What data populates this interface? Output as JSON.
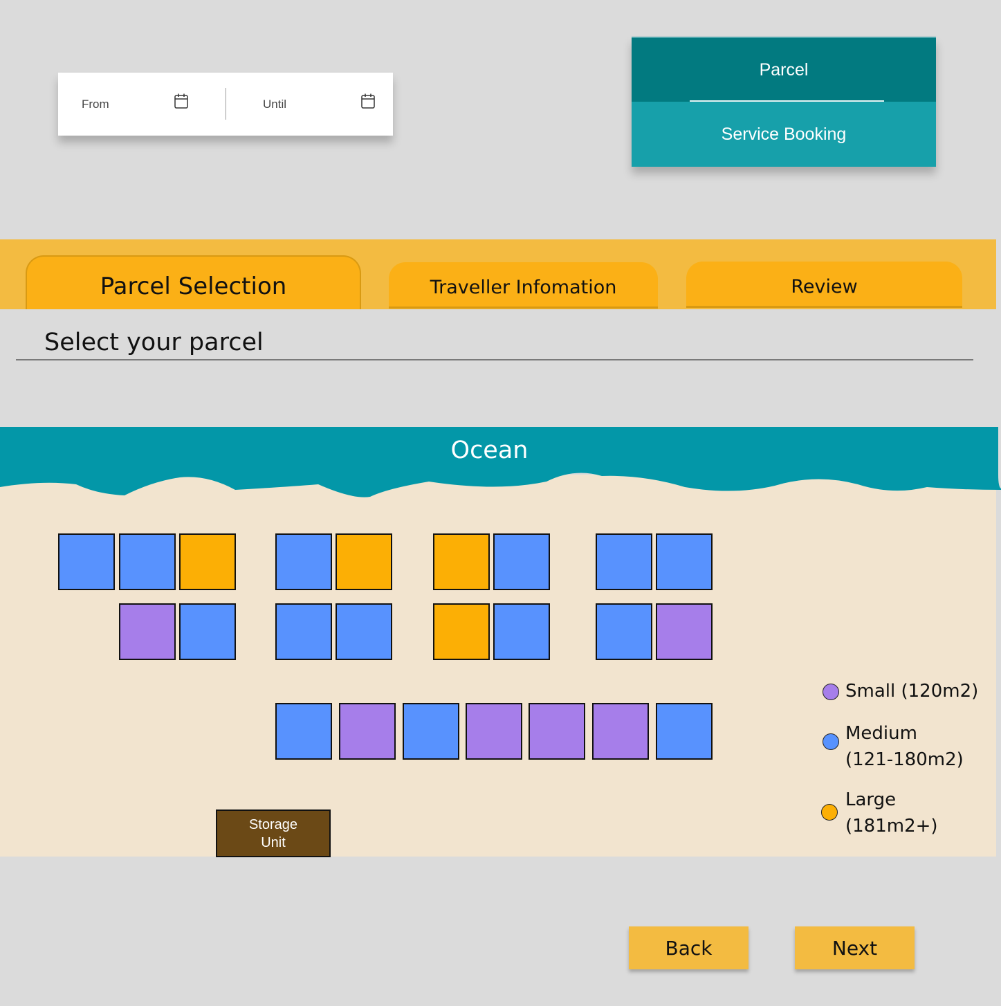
{
  "date_range": {
    "from_label": "From",
    "until_label": "Until",
    "icon": "calendar-icon"
  },
  "mode_switch": {
    "options": [
      "Parcel",
      "Service Booking"
    ],
    "selected": "Parcel",
    "colors": {
      "selected": "#027a80",
      "unselected": "#17a0aa"
    }
  },
  "steps": {
    "items": [
      "Parcel Selection",
      "Traveller Infomation",
      "Review"
    ],
    "active": "Parcel Selection"
  },
  "page": {
    "heading": "Select your parcel"
  },
  "map": {
    "ocean_label": "Ocean",
    "storage_label_line1": "Storage",
    "storage_label_line2": "Unit",
    "parcel_rows": [
      [
        "medium",
        "medium",
        "large",
        "medium",
        "large",
        "large",
        "medium",
        "medium",
        "medium"
      ],
      [
        "small",
        "medium",
        "medium",
        "medium",
        "large",
        "medium",
        "medium",
        "small"
      ],
      [
        "medium",
        "small",
        "medium",
        "small",
        "small",
        "small",
        "medium"
      ]
    ],
    "colors": {
      "small": "#a67eea",
      "medium": "#5892fe",
      "large": "#fcaf05",
      "ocean": "#0397a8",
      "sand": "#f2e4cf",
      "storage": "#6b4916"
    }
  },
  "legend": {
    "small_label": "Small (120m2)",
    "medium_line1": "Medium",
    "medium_line2": "(121-180m2)",
    "large_line1": "Large",
    "large_line2": "(181m2+)"
  },
  "nav": {
    "back_label": "Back",
    "next_label": "Next"
  }
}
